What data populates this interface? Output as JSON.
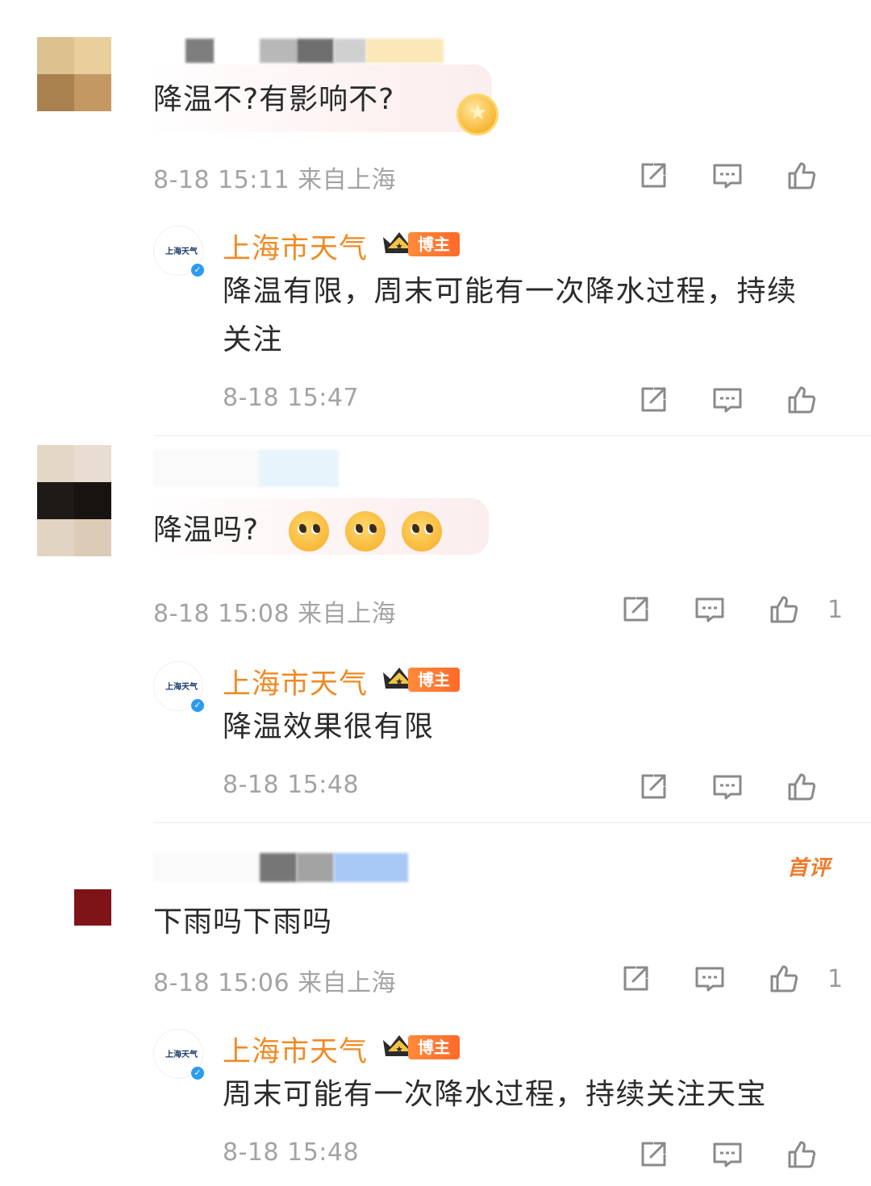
{
  "comments": [
    {
      "text": "降温不?有影响不?",
      "meta": "8-18 15:11  来自上海",
      "likes": "",
      "reply": {
        "name": "上海市天气",
        "tag": "博主",
        "avatar_text": "上海天气",
        "text_line1": "降温有限，周末可能有一次降水过程，持续",
        "text_line2": "关注",
        "meta": "8-18 15:47"
      }
    },
    {
      "text": "降温吗?",
      "meta": "8-18 15:08  来自上海",
      "likes": "1",
      "reply": {
        "name": "上海市天气",
        "tag": "博主",
        "avatar_text": "上海天气",
        "text_line1": "降温效果很有限",
        "meta": "8-18 15:48"
      }
    },
    {
      "text": "下雨吗下雨吗",
      "meta": "8-18 15:06  来自上海",
      "likes": "1",
      "first_badge": "首评",
      "reply": {
        "name": "上海市天气",
        "tag": "博主",
        "avatar_text": "上海天气",
        "text_line1": "周末可能有一次降水过程，持续关注天宝",
        "meta": "8-18 15:48"
      }
    }
  ],
  "icons": {
    "share": "share-icon",
    "comment": "comment-icon",
    "like": "like-icon",
    "crown": "crown-icon",
    "emoji": "pleading-face-emoji"
  },
  "colors": {
    "name_orange": "#f08a24",
    "tag_orange": "#ff7a30",
    "meta_gray": "#a3a3a3",
    "verified_blue": "#2b9bf0"
  }
}
